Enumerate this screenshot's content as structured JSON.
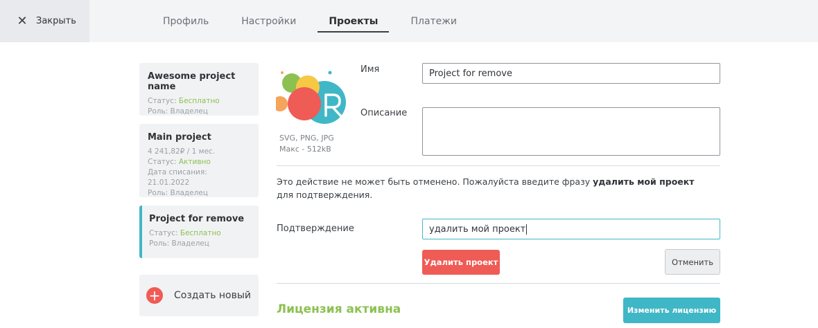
{
  "topbar": {
    "close_label": "Закрыть",
    "tabs": [
      {
        "label": "Профиль"
      },
      {
        "label": "Настройки"
      },
      {
        "label": "Проекты"
      },
      {
        "label": "Платежи"
      }
    ],
    "active_tab": "Проекты"
  },
  "projects": [
    {
      "name": "Awesome project name",
      "status_prefix": "Статус: ",
      "status": "Бесплатно",
      "role": "Роль: Владелец"
    },
    {
      "name": "Main project",
      "price": "4 241,82₽ / 1 мес.",
      "status_prefix": "Статус: ",
      "status": "Активно",
      "billing_date": "Дата списания: 21.01.2022",
      "role": "Роль: Владелец"
    },
    {
      "name": "Project for remove",
      "status_prefix": "Статус: ",
      "status": "Бесплатно",
      "role": "Роль: Владелец",
      "selected": true
    }
  ],
  "create_new_label": "Создать новый",
  "logo": {
    "icon": "project-logo",
    "formats": "SVG, PNG, JPG",
    "max_size": "Макс - 512kB"
  },
  "form": {
    "name_label": "Имя",
    "name_value": "Project for remove",
    "description_label": "Описание",
    "description_value": ""
  },
  "delete": {
    "warning_prefix": "Это действие не может быть отменено. Пожалуйста введите фразу ",
    "phrase": "удалить мой проект",
    "warning_suffix": " для подтверждения.",
    "confirm_label": "Подтверждение",
    "confirm_value": "удалить мой проект",
    "delete_button": "Удалить проект",
    "cancel_button": "Отменить"
  },
  "license": {
    "title": "Лицензия активна",
    "change_button": "Изменить лицензию"
  },
  "colors": {
    "accent": "#40b7c6",
    "danger": "#ef5b55",
    "success": "#8cc152"
  }
}
